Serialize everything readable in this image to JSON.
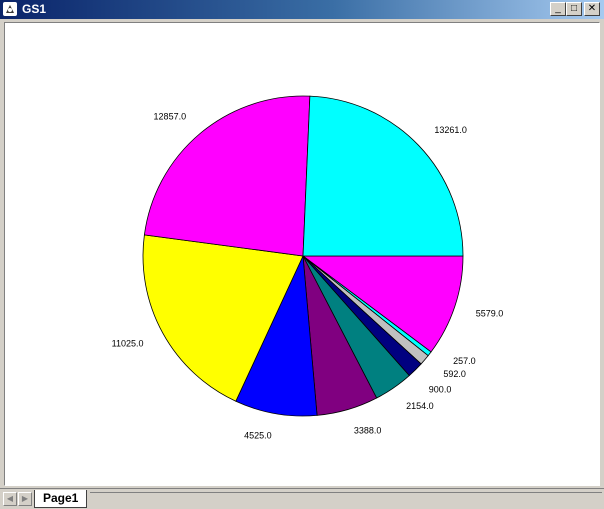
{
  "window": {
    "title": "GS1",
    "icon": "app-icon",
    "controls": {
      "minimize": "_",
      "maximize": "□",
      "close": "✕"
    }
  },
  "sheet_tabs": {
    "active": "Page1",
    "prev_arrow": "◀",
    "next_arrow": "▶"
  },
  "chart_data": {
    "type": "pie",
    "title": "",
    "start": "3 o'clock",
    "direction": "clockwise",
    "legend": "none",
    "slices": [
      {
        "value": 5579.0,
        "label": "5579.0",
        "color": "#ff00ff"
      },
      {
        "value": 257.0,
        "label": "257.0",
        "color": "#00ffff"
      },
      {
        "value": 592.0,
        "label": "592.0",
        "color": "#c0c0c0"
      },
      {
        "value": 900.0,
        "label": "900.0",
        "color": "#000080"
      },
      {
        "value": 2154.0,
        "label": "2154.0",
        "color": "#008080"
      },
      {
        "value": 3388.0,
        "label": "3388.0",
        "color": "#800080"
      },
      {
        "value": 4525.0,
        "label": "4525.0",
        "color": "#0000ff"
      },
      {
        "value": 11025.0,
        "label": "11025.0",
        "color": "#ffff00"
      },
      {
        "value": 12857.0,
        "label": "12857.0",
        "color": "#ff00ff"
      },
      {
        "value": 13261.0,
        "label": "13261.0",
        "color": "#00ffff"
      }
    ]
  }
}
